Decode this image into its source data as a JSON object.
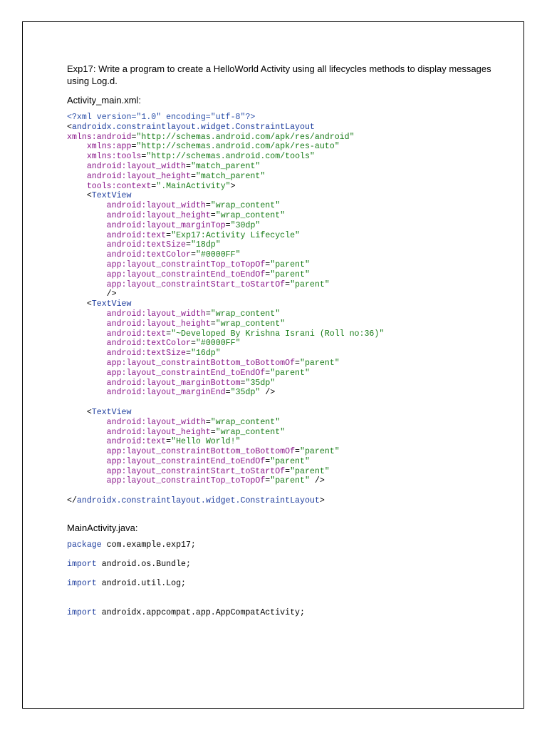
{
  "heading": "Exp17: Write a program to create a HelloWorld Activity using all lifecycles methods to display messages using Log.d.",
  "xml_label": "Activity_main.xml:",
  "xml_lines": [
    [
      {
        "t": "<?xml version=\"1.0\" encoding=\"utf-8\"?>",
        "c": "decl"
      }
    ],
    [
      {
        "t": "<",
        "c": "sym"
      },
      {
        "t": "androidx.constraintlayout.widget.ConstraintLayout",
        "c": "tag"
      }
    ],
    [
      {
        "t": "xmlns:android",
        "c": "attr"
      },
      {
        "t": "=",
        "c": "sym"
      },
      {
        "t": "\"http://schemas.android.com/apk/res/android\"",
        "c": "str"
      }
    ],
    [
      {
        "t": "    xmlns:app",
        "c": "attr"
      },
      {
        "t": "=",
        "c": "sym"
      },
      {
        "t": "\"http://schemas.android.com/apk/res-auto\"",
        "c": "str"
      }
    ],
    [
      {
        "t": "    xmlns:tools",
        "c": "attr"
      },
      {
        "t": "=",
        "c": "sym"
      },
      {
        "t": "\"http://schemas.android.com/tools\"",
        "c": "str"
      }
    ],
    [
      {
        "t": "    android:layout_width",
        "c": "attr"
      },
      {
        "t": "=",
        "c": "sym"
      },
      {
        "t": "\"match_parent\"",
        "c": "str"
      }
    ],
    [
      {
        "t": "    android:layout_height",
        "c": "attr"
      },
      {
        "t": "=",
        "c": "sym"
      },
      {
        "t": "\"match_parent\"",
        "c": "str"
      }
    ],
    [
      {
        "t": "    tools:context",
        "c": "attr"
      },
      {
        "t": "=",
        "c": "sym"
      },
      {
        "t": "\".MainActivity\"",
        "c": "str"
      },
      {
        "t": ">",
        "c": "sym"
      }
    ],
    [
      {
        "t": "    <",
        "c": "sym"
      },
      {
        "t": "TextView",
        "c": "tag"
      }
    ],
    [
      {
        "t": "        android:layout_width",
        "c": "attr"
      },
      {
        "t": "=",
        "c": "sym"
      },
      {
        "t": "\"wrap_content\"",
        "c": "str"
      }
    ],
    [
      {
        "t": "        android:layout_height",
        "c": "attr"
      },
      {
        "t": "=",
        "c": "sym"
      },
      {
        "t": "\"wrap_content\"",
        "c": "str"
      }
    ],
    [
      {
        "t": "        android:layout_marginTop",
        "c": "attr"
      },
      {
        "t": "=",
        "c": "sym"
      },
      {
        "t": "\"30dp\"",
        "c": "str"
      }
    ],
    [
      {
        "t": "        android:text",
        "c": "attr"
      },
      {
        "t": "=",
        "c": "sym"
      },
      {
        "t": "\"Exp17:Activity Lifecycle\"",
        "c": "str"
      }
    ],
    [
      {
        "t": "        android:textSize",
        "c": "attr"
      },
      {
        "t": "=",
        "c": "sym"
      },
      {
        "t": "\"18dp\"",
        "c": "str"
      }
    ],
    [
      {
        "t": "        android:textColor",
        "c": "attr"
      },
      {
        "t": "=",
        "c": "sym"
      },
      {
        "t": "\"#0000FF\"",
        "c": "str"
      }
    ],
    [
      {
        "t": "        app:layout_constraintTop_toTopOf",
        "c": "attr"
      },
      {
        "t": "=",
        "c": "sym"
      },
      {
        "t": "\"parent\"",
        "c": "str"
      }
    ],
    [
      {
        "t": "        app:layout_constraintEnd_toEndOf",
        "c": "attr"
      },
      {
        "t": "=",
        "c": "sym"
      },
      {
        "t": "\"parent\"",
        "c": "str"
      }
    ],
    [
      {
        "t": "        app:layout_constraintStart_toStartOf",
        "c": "attr"
      },
      {
        "t": "=",
        "c": "sym"
      },
      {
        "t": "\"parent\"",
        "c": "str"
      }
    ],
    [
      {
        "t": "        />",
        "c": "sym"
      }
    ],
    [
      {
        "t": "    <",
        "c": "sym"
      },
      {
        "t": "TextView",
        "c": "tag"
      }
    ],
    [
      {
        "t": "        android:layout_width",
        "c": "attr"
      },
      {
        "t": "=",
        "c": "sym"
      },
      {
        "t": "\"wrap_content\"",
        "c": "str"
      }
    ],
    [
      {
        "t": "        android:layout_height",
        "c": "attr"
      },
      {
        "t": "=",
        "c": "sym"
      },
      {
        "t": "\"wrap_content\"",
        "c": "str"
      }
    ],
    [
      {
        "t": "        android:text",
        "c": "attr"
      },
      {
        "t": "=",
        "c": "sym"
      },
      {
        "t": "\"~Developed By Krishna Israni (Roll no:36)\"",
        "c": "str"
      }
    ],
    [
      {
        "t": "        android:textColor",
        "c": "attr"
      },
      {
        "t": "=",
        "c": "sym"
      },
      {
        "t": "\"#0000FF\"",
        "c": "str"
      }
    ],
    [
      {
        "t": "        android:textSize",
        "c": "attr"
      },
      {
        "t": "=",
        "c": "sym"
      },
      {
        "t": "\"16dp\"",
        "c": "str"
      }
    ],
    [
      {
        "t": "        app:layout_constraintBottom_toBottomOf",
        "c": "attr"
      },
      {
        "t": "=",
        "c": "sym"
      },
      {
        "t": "\"parent\"",
        "c": "str"
      }
    ],
    [
      {
        "t": "        app:layout_constraintEnd_toEndOf",
        "c": "attr"
      },
      {
        "t": "=",
        "c": "sym"
      },
      {
        "t": "\"parent\"",
        "c": "str"
      }
    ],
    [
      {
        "t": "        android:layout_marginBottom",
        "c": "attr"
      },
      {
        "t": "=",
        "c": "sym"
      },
      {
        "t": "\"35dp\"",
        "c": "str"
      }
    ],
    [
      {
        "t": "        android:layout_marginEnd",
        "c": "attr"
      },
      {
        "t": "=",
        "c": "sym"
      },
      {
        "t": "\"35dp\"",
        "c": "str"
      },
      {
        "t": " />",
        "c": "sym"
      }
    ],
    [],
    [
      {
        "t": "    <",
        "c": "sym"
      },
      {
        "t": "TextView",
        "c": "tag"
      }
    ],
    [
      {
        "t": "        android:layout_width",
        "c": "attr"
      },
      {
        "t": "=",
        "c": "sym"
      },
      {
        "t": "\"wrap_content\"",
        "c": "str"
      }
    ],
    [
      {
        "t": "        android:layout_height",
        "c": "attr"
      },
      {
        "t": "=",
        "c": "sym"
      },
      {
        "t": "\"wrap_content\"",
        "c": "str"
      }
    ],
    [
      {
        "t": "        android:text",
        "c": "attr"
      },
      {
        "t": "=",
        "c": "sym"
      },
      {
        "t": "\"Hello World!\"",
        "c": "str"
      }
    ],
    [
      {
        "t": "        app:layout_constraintBottom_toBottomOf",
        "c": "attr"
      },
      {
        "t": "=",
        "c": "sym"
      },
      {
        "t": "\"parent\"",
        "c": "str"
      }
    ],
    [
      {
        "t": "        app:layout_constraintEnd_toEndOf",
        "c": "attr"
      },
      {
        "t": "=",
        "c": "sym"
      },
      {
        "t": "\"parent\"",
        "c": "str"
      }
    ],
    [
      {
        "t": "        app:layout_constraintStart_toStartOf",
        "c": "attr"
      },
      {
        "t": "=",
        "c": "sym"
      },
      {
        "t": "\"parent\"",
        "c": "str"
      }
    ],
    [
      {
        "t": "        app:layout_constraintTop_toTopOf",
        "c": "attr"
      },
      {
        "t": "=",
        "c": "sym"
      },
      {
        "t": "\"parent\"",
        "c": "str"
      },
      {
        "t": " />",
        "c": "sym"
      }
    ],
    [],
    [
      {
        "t": "</",
        "c": "sym"
      },
      {
        "t": "androidx.constraintlayout.widget.ConstraintLayout",
        "c": "tag"
      },
      {
        "t": ">",
        "c": "sym"
      }
    ]
  ],
  "java_label": "MainActivity.java:",
  "java_lines": [
    [
      {
        "t": "package",
        "c": "kw"
      },
      {
        "t": " com.example.exp17;",
        "c": "sym"
      }
    ],
    [
      {
        "t": "import",
        "c": "kw"
      },
      {
        "t": " android.os.Bundle;",
        "c": "sym"
      }
    ],
    [
      {
        "t": "import",
        "c": "kw"
      },
      {
        "t": " android.util.Log;",
        "c": "sym"
      }
    ],
    [
      {
        "t": "import",
        "c": "kw"
      },
      {
        "t": " androidx.appcompat.app.AppCompatActivity;",
        "c": "sym"
      }
    ]
  ]
}
